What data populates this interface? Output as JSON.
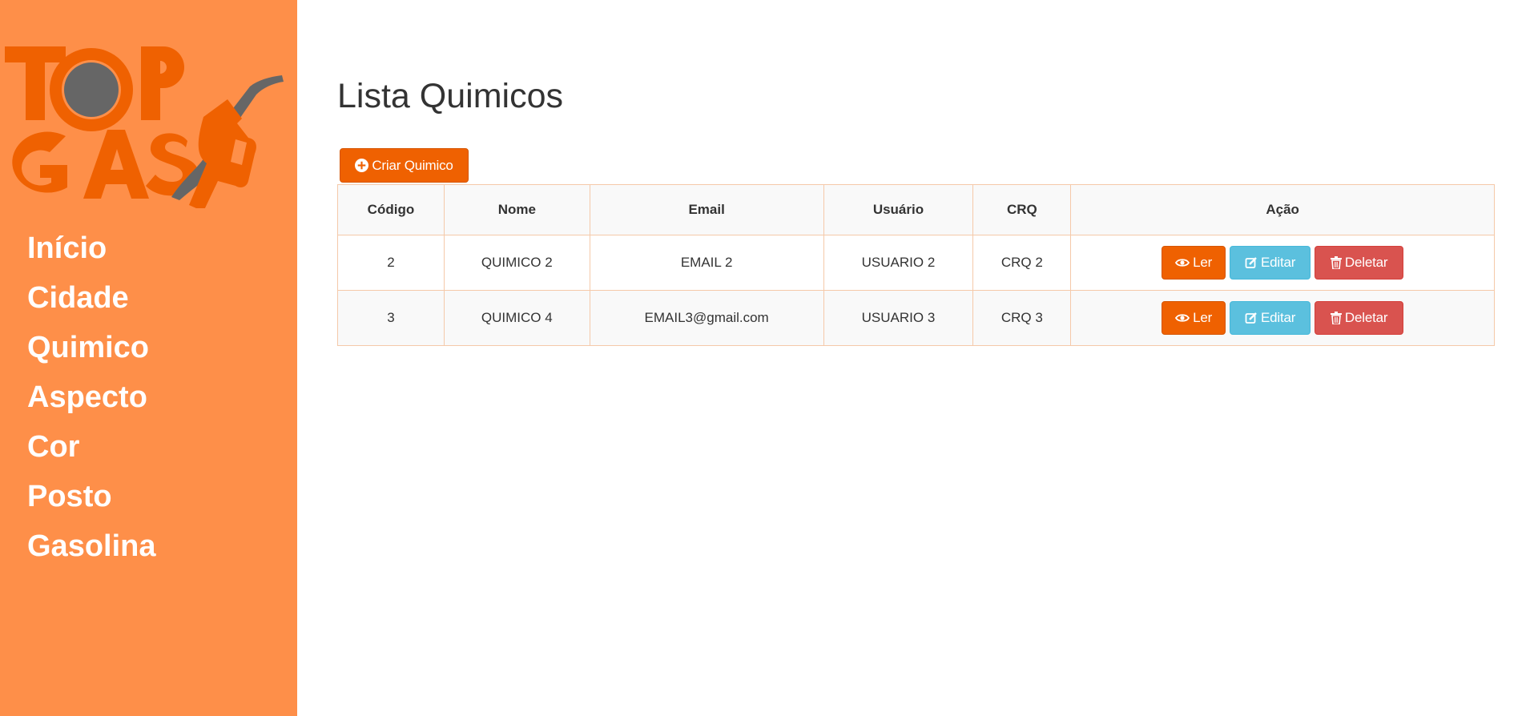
{
  "brand": {
    "logo_line1": "TOP",
    "logo_line2": "GAS",
    "primary_color": "#fe8f49",
    "accent_color": "#ef6101",
    "logo_icon": "fuel-nozzle-icon"
  },
  "sidebar": {
    "items": [
      {
        "label": "Início"
      },
      {
        "label": "Cidade"
      },
      {
        "label": "Quimico"
      },
      {
        "label": "Aspecto"
      },
      {
        "label": "Cor"
      },
      {
        "label": "Posto"
      },
      {
        "label": "Gasolina"
      }
    ]
  },
  "main": {
    "title": "Lista Quimicos",
    "create_button": {
      "label": "Criar Quimico",
      "icon": "plus-circle-icon"
    },
    "table": {
      "headers": [
        "Código",
        "Nome",
        "Email",
        "Usuário",
        "CRQ",
        "Ação"
      ],
      "rows": [
        {
          "codigo": "2",
          "nome": "QUIMICO 2",
          "email": "EMAIL 2",
          "usuario": "USUARIO 2",
          "crq": "CRQ 2"
        },
        {
          "codigo": "3",
          "nome": "QUIMICO 4",
          "email": "EMAIL3@gmail.com",
          "usuario": "USUARIO 3",
          "crq": "CRQ 3"
        }
      ],
      "actions": {
        "read_label": "Ler",
        "read_icon": "eye-icon",
        "read_color": "#ef6101",
        "edit_label": "Editar",
        "edit_icon": "edit-icon",
        "edit_color": "#5bc0de",
        "delete_label": "Deletar",
        "delete_icon": "trash-icon",
        "delete_color": "#d9534f"
      }
    }
  }
}
